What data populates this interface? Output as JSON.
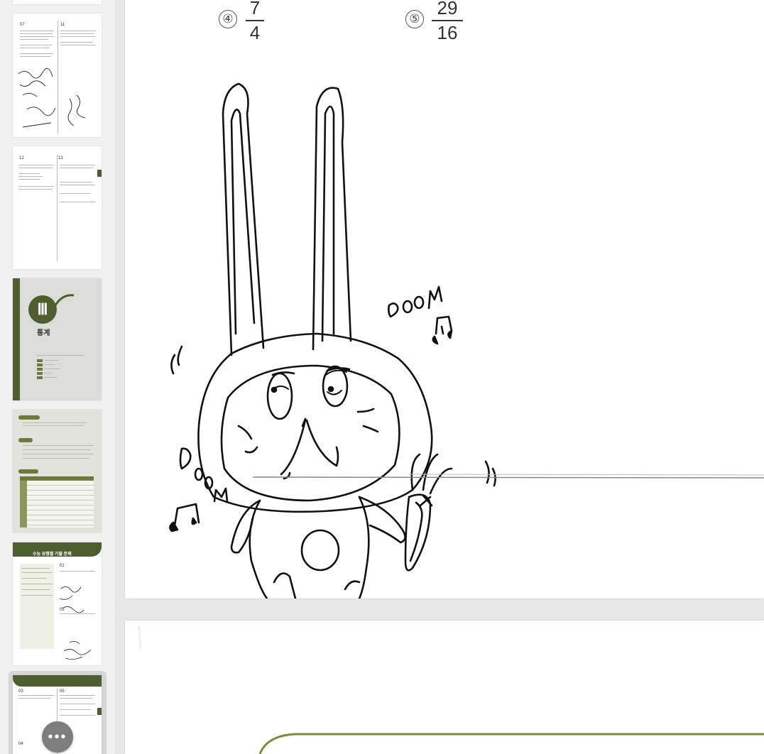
{
  "sidebar": {
    "thumbnails": [
      {
        "kind": "worksheet",
        "problems": [
          "07",
          "11"
        ]
      },
      {
        "kind": "worksheet",
        "problems": [
          "12",
          "13"
        ]
      },
      {
        "kind": "chapter-cover",
        "numeral": "Ⅲ",
        "title": "통계"
      },
      {
        "kind": "study-table"
      },
      {
        "kind": "exam-problems",
        "heading": "수능 유형별 기출 문제",
        "problems": [
          "01",
          "02"
        ]
      },
      {
        "kind": "worksheet",
        "problems": [
          "03",
          "05",
          "04"
        ],
        "selected": true
      }
    ],
    "more_label": "•••",
    "accent_color": "#4f5e2e"
  },
  "page": {
    "options": [
      {
        "marker": "④",
        "numerator": "7",
        "denominator": "4"
      },
      {
        "marker": "⑤",
        "numerator": "29",
        "denominator": "16"
      }
    ],
    "doodle_text": [
      "DOOM",
      "DooM"
    ]
  }
}
